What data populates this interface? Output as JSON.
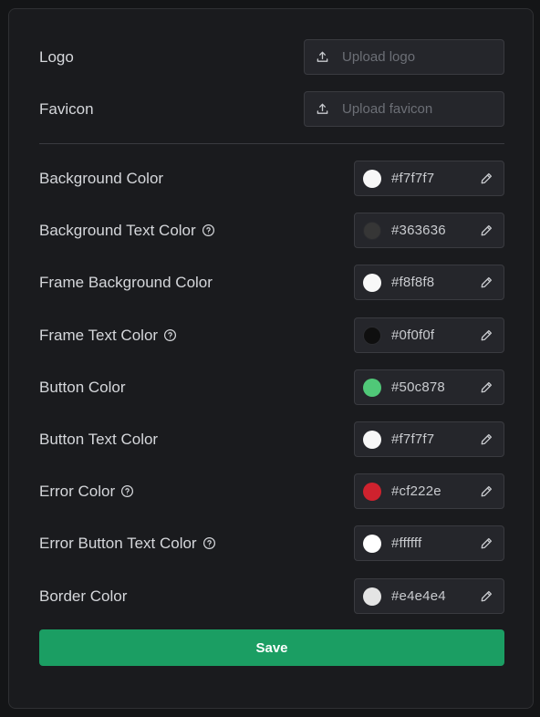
{
  "branding": {
    "logo": {
      "label": "Logo",
      "placeholder": "Upload logo",
      "icon": "upload-icon"
    },
    "favicon": {
      "label": "Favicon",
      "placeholder": "Upload favicon",
      "icon": "upload-icon"
    }
  },
  "colors": [
    {
      "label": "Background Color",
      "value": "#f7f7f7",
      "help": false
    },
    {
      "label": "Background Text Color",
      "value": "#363636",
      "help": true
    },
    {
      "label": "Frame Background Color",
      "value": "#f8f8f8",
      "help": false
    },
    {
      "label": "Frame Text Color",
      "value": "#0f0f0f",
      "help": true
    },
    {
      "label": "Button Color",
      "value": "#50c878",
      "help": false
    },
    {
      "label": "Button Text Color",
      "value": "#f7f7f7",
      "help": false
    },
    {
      "label": "Error Color",
      "value": "#cf222e",
      "help": true
    },
    {
      "label": "Error Button Text Color",
      "value": "#ffffff",
      "help": true
    },
    {
      "label": "Border Color",
      "value": "#e4e4e4",
      "help": false
    }
  ],
  "icons": {
    "help": "help-circle-icon",
    "picker": "pencil-icon"
  },
  "theme": {
    "accent": "#1b9e63"
  },
  "actions": {
    "save_label": "Save"
  }
}
